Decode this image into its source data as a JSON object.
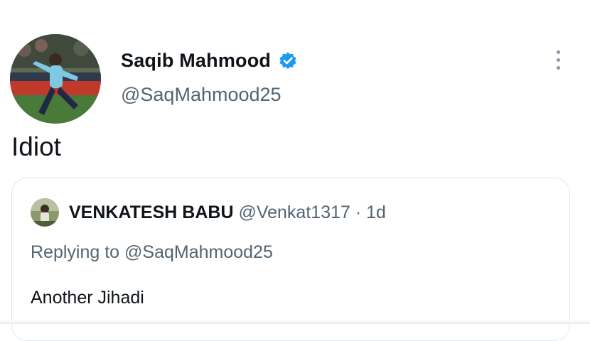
{
  "tweet": {
    "author": {
      "display_name": "Saqib Mahmood",
      "handle": "@SaqMahmood25",
      "verified": true,
      "avatar_icon": "cricketer-photo-avatar"
    },
    "more_icon": "more-vertical-icon",
    "text": "Idiot",
    "quoted": {
      "author": {
        "display_name": "VENKATESH BABU",
        "handle": "@Venkat1317",
        "avatar_icon": "user-photo-avatar"
      },
      "separator": "·",
      "time": "1d",
      "replying_to": "Replying to @SaqMahmood25",
      "text": "Another Jihadi"
    }
  },
  "colors": {
    "verified_blue": "#1d9bf0",
    "secondary_text": "#536471",
    "primary_text": "#0f1419",
    "border": "#e2e6ea"
  }
}
